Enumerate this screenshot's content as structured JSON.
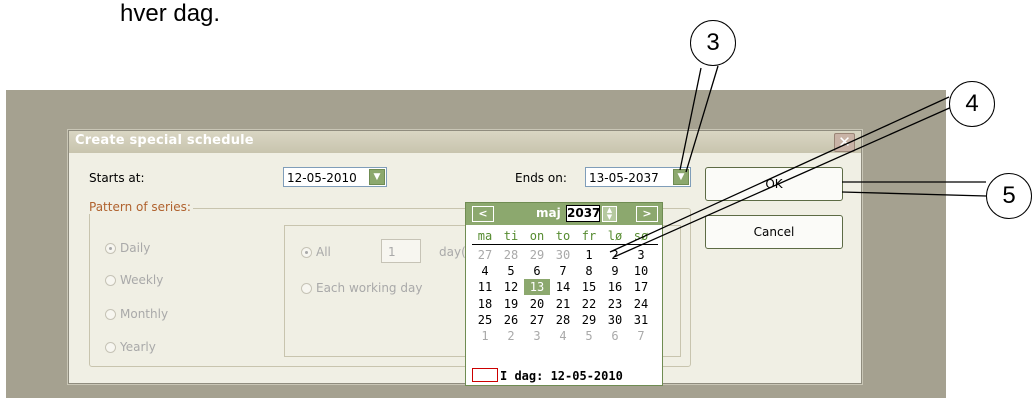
{
  "doc_text": "hver dag.",
  "dialog": {
    "title": "Create special schedule",
    "close_symbol": "✕",
    "starts_label": "Starts at:",
    "starts_value": "12-05-2010",
    "ends_label": "Ends on:",
    "ends_value": "13-05-2037",
    "ok_label": "OK",
    "cancel_label": "Cancel",
    "pattern_label": "Pattern of series:",
    "patterns": [
      "Daily",
      "Weekly",
      "Monthly",
      "Yearly"
    ],
    "all_label": "All",
    "all_value": "1",
    "days_label": "day(s",
    "each_working_label": "Each working day"
  },
  "calendar": {
    "month": "maj",
    "year": "2037",
    "prev_symbol": "<",
    "next_symbol": ">",
    "weekdays": [
      "ma",
      "ti",
      "on",
      "to",
      "fr",
      "lø",
      "sø"
    ],
    "weeks": [
      [
        "27",
        "28",
        "29",
        "30",
        "1",
        "2",
        "3"
      ],
      [
        "4",
        "5",
        "6",
        "7",
        "8",
        "9",
        "10"
      ],
      [
        "11",
        "12",
        "13",
        "14",
        "15",
        "16",
        "17"
      ],
      [
        "18",
        "19",
        "20",
        "21",
        "22",
        "23",
        "24"
      ],
      [
        "25",
        "26",
        "27",
        "28",
        "29",
        "30",
        "31"
      ],
      [
        "1",
        "2",
        "3",
        "4",
        "5",
        "6",
        "7"
      ]
    ],
    "selected_day": "13",
    "today_label": "I dag: 12-05-2010"
  },
  "callouts": [
    "3",
    "4",
    "5"
  ],
  "colors": {
    "accent_green": "#8ca86e",
    "backdrop": "#a5a190",
    "dialog_bg": "#f0efe4",
    "group_label": "#b0622e"
  },
  "icons": {
    "dropdown": "chevron-down-icon",
    "close": "close-icon",
    "prev": "chevron-left-icon",
    "next": "chevron-right-icon",
    "spin": "spin-icon"
  }
}
